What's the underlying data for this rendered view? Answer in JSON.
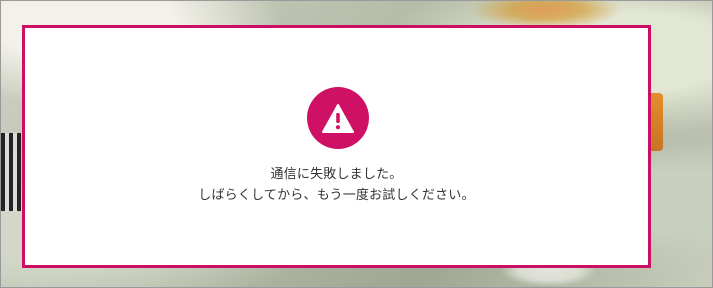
{
  "modal": {
    "icon": "warning-icon",
    "accent_color": "#cc0f63",
    "icon_color": "#cf1166",
    "message_line_1": "通信に失敗しました。",
    "message_line_2": "しばらくしてから、もう一度お試しください。"
  }
}
